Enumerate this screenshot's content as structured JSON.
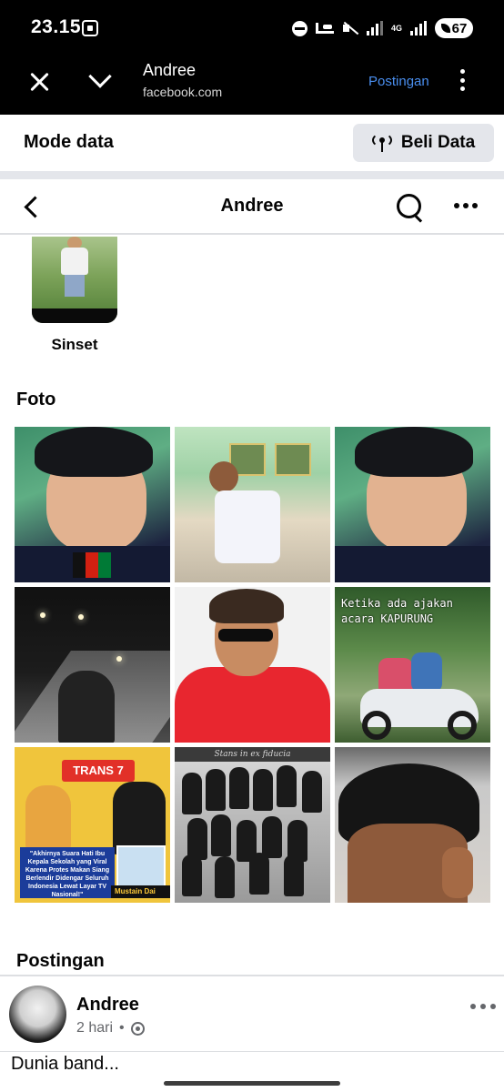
{
  "status_bar": {
    "time": "23.15",
    "network": "4G",
    "battery": "67",
    "icons": [
      "screenshot-icon",
      "dnd-icon",
      "sleep-icon",
      "mute-icon",
      "signal-icon",
      "battery-icon"
    ]
  },
  "browser": {
    "page_name": "Andree",
    "url": "facebook.com",
    "action_label": "Postingan"
  },
  "data_mode": {
    "label": "Mode data",
    "button_label": "Beli Data"
  },
  "profile_nav": {
    "title": "Andree"
  },
  "highlight": {
    "label": "Sinset"
  },
  "photos": {
    "title": "Foto",
    "caption_6_line1": "Ketika ada ajakan",
    "caption_6_line2": "acara KAPURUNG",
    "logo_7": "TRANS 7",
    "quote_7": "\"Akhirnya Suara Hati Ibu Kepala Sekolah yang Viral Karena Protes Makan Siang Berlendir Didengar Seluruh Indonesia Lewat Layar TV Nasional!\"",
    "nameplate_7": "Mustain Dai",
    "banner_8": "Stans in ex fiducia"
  },
  "posts": {
    "title": "Postingan",
    "author": "Andree",
    "time": "2 hari",
    "separator": "•",
    "text": "Dunia band..."
  }
}
